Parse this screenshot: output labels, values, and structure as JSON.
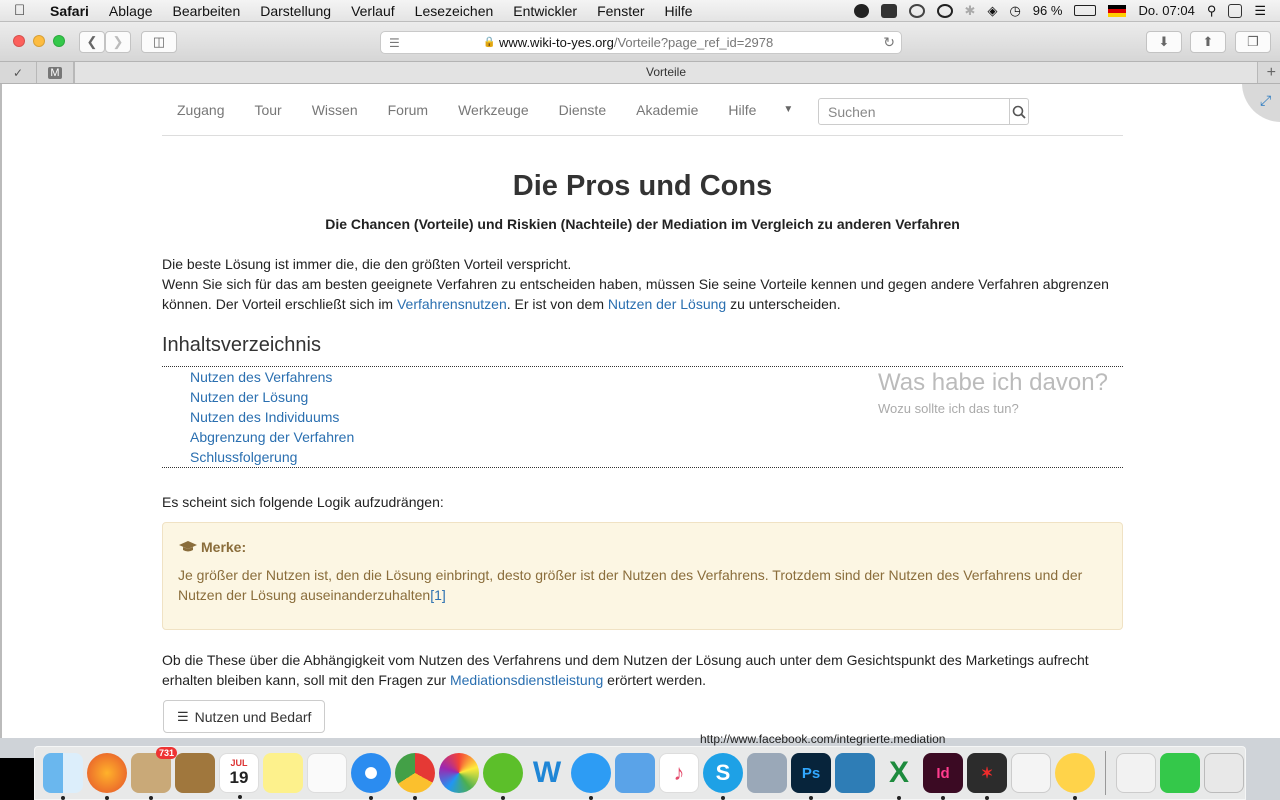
{
  "menubar": {
    "app": "Safari",
    "items": [
      "Ablage",
      "Bearbeiten",
      "Darstellung",
      "Verlauf",
      "Lesezeichen",
      "Entwickler",
      "Fenster",
      "Hilfe"
    ],
    "battery": "96 %",
    "clock": "Do. 07:04"
  },
  "browser": {
    "url_host": "www.wiki-to-yes.org",
    "url_path": "/Vorteile?page_ref_id=2978",
    "tab_title": "Vorteile"
  },
  "nav": {
    "items": [
      "Zugang",
      "Tour",
      "Wissen",
      "Forum",
      "Werkzeuge",
      "Dienste",
      "Akademie",
      "Hilfe"
    ],
    "search_placeholder": "Suchen"
  },
  "page": {
    "title": "Die Pros und Cons",
    "subtitle": "Die Chancen (Vorteile) und Riskien (Nachteile) der Mediation im Vergleich zu anderen Verfahren",
    "intro_line1": "Die beste Lösung ist immer die, die den größten Vorteil verspricht.",
    "intro_line2": "Wenn Sie sich für das am besten geeignete Verfahren zu entscheiden haben, müssen Sie seine Vorteile kennen und gegen andere Verfahren abgrenzen können. Der Vorteil erschließt sich im ",
    "intro_link1": "Verfahrensnutzen",
    "intro_mid": ". Er ist von dem ",
    "intro_link2": "Nutzen der Lösung",
    "intro_end": " zu unterscheiden.",
    "toc_heading": "Inhaltsverzeichnis",
    "toc": [
      "Nutzen des Verfahrens",
      "Nutzen der Lösung",
      "Nutzen des Individuums",
      "Abgrenzung der Verfahren",
      "Schlussfolgerung"
    ],
    "toc_side_title": "Was habe ich davon?",
    "toc_side_sub": "Wozu sollte ich das tun?",
    "logic_text": "Es scheint sich folgende Logik aufzudrängen:",
    "merke_title": "Merke:",
    "merke_text": "Je größer der Nutzen ist, den die Lösung einbringt, desto größer ist der Nutzen des Verfahrens. Trotzdem sind der Nutzen des Verfahrens und der Nutzen der Lösung auseinanderzuhalten",
    "merke_ref": "[1]",
    "these_text": "Ob die These über die Abhängigkeit vom Nutzen des Verfahrens und dem Nutzen der Lösung auch unter dem Gesichtspunkt des Marketings aufrecht erhalten bleiben kann, soll mit den Fragen zur ",
    "these_link": "Mediationsdienstleistung",
    "these_end": " erörtert werden.",
    "button_label": "Nutzen und Bedarf"
  },
  "dock": {
    "mail_badge": "731",
    "calendar_month": "JUL",
    "calendar_day": "19",
    "background_text": "http://www.facebook.com/integrierte.mediation"
  }
}
